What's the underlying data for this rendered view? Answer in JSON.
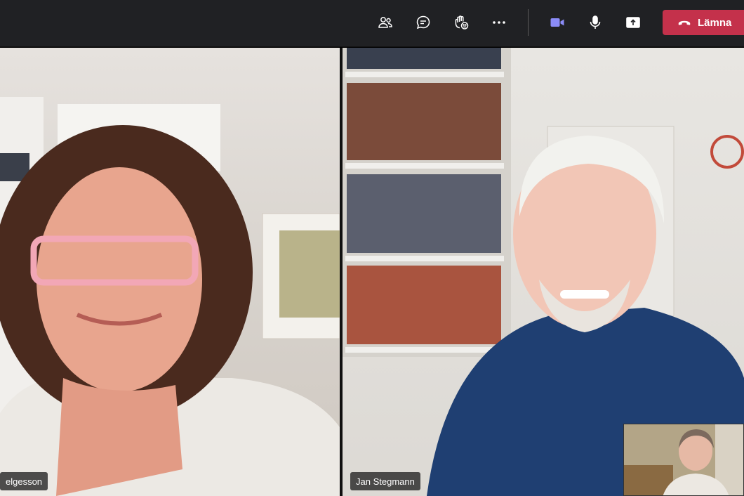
{
  "toolbar": {
    "icons": [
      "participants-icon",
      "chat-icon",
      "reactions-icon",
      "more-icon",
      "camera-icon",
      "microphone-icon",
      "share-icon"
    ],
    "leave_label": "Lämna",
    "accent_color": "#c4314b",
    "camera_color": "#8b8cf8"
  },
  "participants": [
    {
      "name": "elgesson"
    },
    {
      "name": "Jan Stegmann"
    }
  ]
}
